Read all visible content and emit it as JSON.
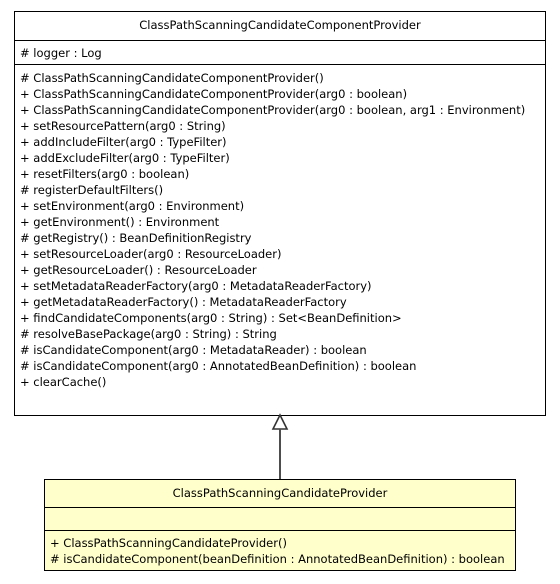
{
  "diagram": {
    "type": "uml-class-diagram",
    "relationship": "generalization",
    "colors": {
      "superclass_fill": "#ffffff",
      "subclass_fill": "#ffffcc",
      "border": "#000000",
      "connector": "#4d4d4d"
    }
  },
  "superclass": {
    "name": "ClassPathScanningCandidateComponentProvider",
    "fields": [
      "# logger : Log"
    ],
    "methods": [
      "# ClassPathScanningCandidateComponentProvider()",
      "+ ClassPathScanningCandidateComponentProvider(arg0 : boolean)",
      "+ ClassPathScanningCandidateComponentProvider(arg0 : boolean, arg1 : Environment)",
      "+ setResourcePattern(arg0 : String)",
      "+ addIncludeFilter(arg0 : TypeFilter)",
      "+ addExcludeFilter(arg0 : TypeFilter)",
      "+ resetFilters(arg0 : boolean)",
      "# registerDefaultFilters()",
      "+ setEnvironment(arg0 : Environment)",
      "+ getEnvironment() : Environment",
      "# getRegistry() : BeanDefinitionRegistry",
      "+ setResourceLoader(arg0 : ResourceLoader)",
      "+ getResourceLoader() : ResourceLoader",
      "+ setMetadataReaderFactory(arg0 : MetadataReaderFactory)",
      "+ getMetadataReaderFactory() : MetadataReaderFactory",
      "+ findCandidateComponents(arg0 : String) : Set<BeanDefinition>",
      "# resolveBasePackage(arg0 : String) : String",
      "# isCandidateComponent(arg0 : MetadataReader) : boolean",
      "# isCandidateComponent(arg0 : AnnotatedBeanDefinition) : boolean",
      "+ clearCache()"
    ]
  },
  "subclass": {
    "name": "ClassPathScanningCandidateProvider",
    "fields": [],
    "methods": [
      "+ ClassPathScanningCandidateProvider()",
      "# isCandidateComponent(beanDefinition : AnnotatedBeanDefinition) : boolean"
    ]
  }
}
